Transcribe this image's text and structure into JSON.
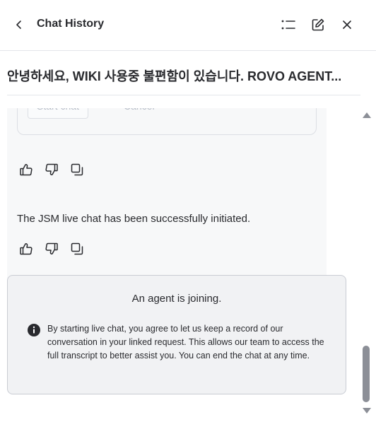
{
  "header": {
    "title": "Chat History",
    "icons": [
      "back-chevron-icon",
      "list-icon",
      "edit-icon",
      "close-icon"
    ]
  },
  "conversation": {
    "title": "안녕하세요, WIKI 사용중 불편함이 있습니다. ROVO AGENT..."
  },
  "messages": [
    {
      "buttons": {
        "start_chat": "Start chat",
        "cancel": "Cancel"
      },
      "reactions": [
        "thumbs-up-icon",
        "thumbs-down-icon",
        "copy-icon"
      ]
    },
    {
      "text": "The JSM live chat has been successfully initiated.",
      "reactions": [
        "thumbs-up-icon",
        "thumbs-down-icon",
        "copy-icon"
      ]
    }
  ],
  "agent_panel": {
    "heading": "An agent is joining.",
    "notice": "By starting live chat, you agree to let us keep a record of our conversation in your linked request. This allows our team to access the full transcript to better assist you. You can end the chat at any time."
  },
  "colors": {
    "text": "#292a2e",
    "card_bg": "#f7f8f9",
    "panel_bg": "#f1f2f4",
    "border": "#c9ccd3",
    "disabled_text": "#b3b9c4"
  }
}
